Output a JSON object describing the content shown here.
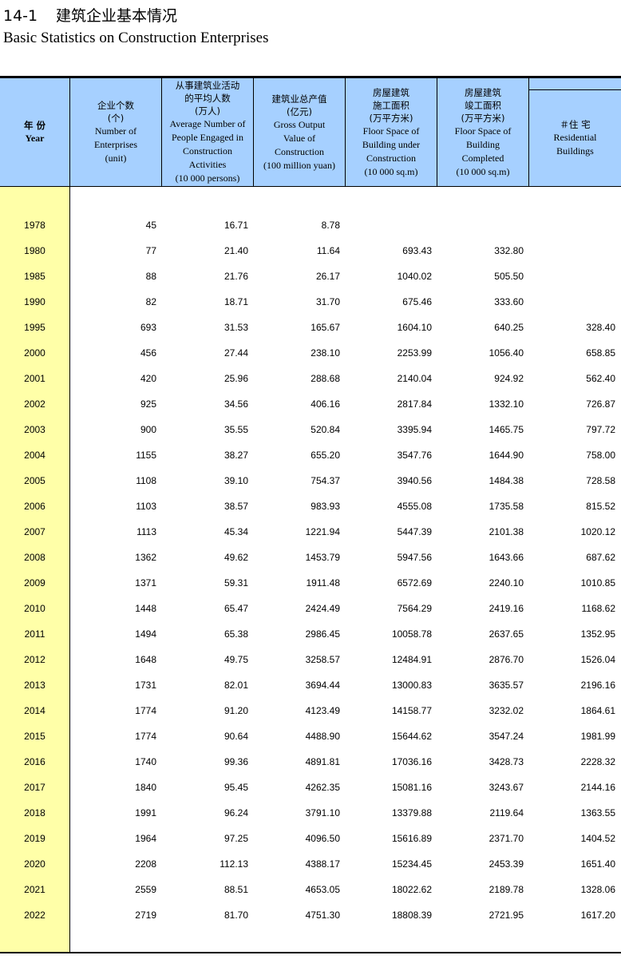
{
  "title": {
    "number": "14-1",
    "cn": "建筑企业基本情况",
    "en": "Basic Statistics on Construction Enterprises"
  },
  "headers": [
    {
      "cn": [
        "年 份"
      ],
      "en": [
        "Year"
      ]
    },
    {
      "cn": [
        "企业个数",
        "(个)"
      ],
      "en": [
        "Number of",
        "Enterprises",
        "(unit)"
      ]
    },
    {
      "cn": [
        "从事建筑业活动",
        "的平均人数",
        "(万人)"
      ],
      "en": [
        "Average Number of",
        "People Engaged in",
        "Construction",
        "Activities",
        "(10 000 persons)"
      ]
    },
    {
      "cn": [
        "建筑业总产值",
        "(亿元)"
      ],
      "en": [
        "Gross Output",
        "Value of",
        "Construction",
        "(100 million yuan)"
      ]
    },
    {
      "cn": [
        "房屋建筑",
        "施工面积",
        "(万平方米)"
      ],
      "en": [
        "Floor Space of",
        "Building under",
        "Construction",
        "(10 000 sq.m)"
      ]
    },
    {
      "cn": [
        "房屋建筑",
        "竣工面积",
        "(万平方米)"
      ],
      "en": [
        "Floor Space of",
        "Building",
        "Completed",
        "(10 000 sq.m)"
      ]
    },
    {
      "cn": [
        "＃住 宅"
      ],
      "en": [
        "Residential",
        "Buildings"
      ]
    }
  ],
  "rows": [
    [
      "1978",
      "45",
      "16.71",
      "8.78",
      "",
      "",
      ""
    ],
    [
      "1980",
      "77",
      "21.40",
      "11.64",
      "693.43",
      "332.80",
      ""
    ],
    [
      "1985",
      "88",
      "21.76",
      "26.17",
      "1040.02",
      "505.50",
      ""
    ],
    [
      "1990",
      "82",
      "18.71",
      "31.70",
      "675.46",
      "333.60",
      ""
    ],
    [
      "1995",
      "693",
      "31.53",
      "165.67",
      "1604.10",
      "640.25",
      "328.40"
    ],
    [
      "2000",
      "456",
      "27.44",
      "238.10",
      "2253.99",
      "1056.40",
      "658.85"
    ],
    [
      "2001",
      "420",
      "25.96",
      "288.68",
      "2140.04",
      "924.92",
      "562.40"
    ],
    [
      "2002",
      "925",
      "34.56",
      "406.16",
      "2817.84",
      "1332.10",
      "726.87"
    ],
    [
      "2003",
      "900",
      "35.55",
      "520.84",
      "3395.94",
      "1465.75",
      "797.72"
    ],
    [
      "2004",
      "1155",
      "38.27",
      "655.20",
      "3547.76",
      "1644.90",
      "758.00"
    ],
    [
      "2005",
      "1108",
      "39.10",
      "754.37",
      "3940.56",
      "1484.38",
      "728.58"
    ],
    [
      "2006",
      "1103",
      "38.57",
      "983.93",
      "4555.08",
      "1735.58",
      "815.52"
    ],
    [
      "2007",
      "1113",
      "45.34",
      "1221.94",
      "5447.39",
      "2101.38",
      "1020.12"
    ],
    [
      "2008",
      "1362",
      "49.62",
      "1453.79",
      "5947.56",
      "1643.66",
      "687.62"
    ],
    [
      "2009",
      "1371",
      "59.31",
      "1911.48",
      "6572.69",
      "2240.10",
      "1010.85"
    ],
    [
      "2010",
      "1448",
      "65.47",
      "2424.49",
      "7564.29",
      "2419.16",
      "1168.62"
    ],
    [
      "2011",
      "1494",
      "65.38",
      "2986.45",
      "10058.78",
      "2637.65",
      "1352.95"
    ],
    [
      "2012",
      "1648",
      "49.75",
      "3258.57",
      "12484.91",
      "2876.70",
      "1526.04"
    ],
    [
      "2013",
      "1731",
      "82.01",
      "3694.44",
      "13000.83",
      "3635.57",
      "2196.16"
    ],
    [
      "2014",
      "1774",
      "91.20",
      "4123.49",
      "14158.77",
      "3232.02",
      "1864.61"
    ],
    [
      "2015",
      "1774",
      "90.64",
      "4488.90",
      "15644.62",
      "3547.24",
      "1981.99"
    ],
    [
      "2016",
      "1740",
      "99.36",
      "4891.81",
      "17036.16",
      "3428.73",
      "2228.32"
    ],
    [
      "2017",
      "1840",
      "95.45",
      "4262.35",
      "15081.16",
      "3243.67",
      "2144.16"
    ],
    [
      "2018",
      "1991",
      "96.24",
      "3791.10",
      "13379.88",
      "2119.64",
      "1363.55"
    ],
    [
      "2019",
      "1964",
      "97.25",
      "4096.50",
      "15616.89",
      "2371.70",
      "1404.52"
    ],
    [
      "2020",
      "2208",
      "112.13",
      "4388.17",
      "15234.45",
      "2453.39",
      "1651.40"
    ],
    [
      "2021",
      "2559",
      "88.51",
      "4653.05",
      "18022.62",
      "2189.78",
      "1328.06"
    ],
    [
      "2022",
      "2719",
      "81.70",
      "4751.30",
      "18808.39",
      "2721.95",
      "1617.20"
    ]
  ]
}
